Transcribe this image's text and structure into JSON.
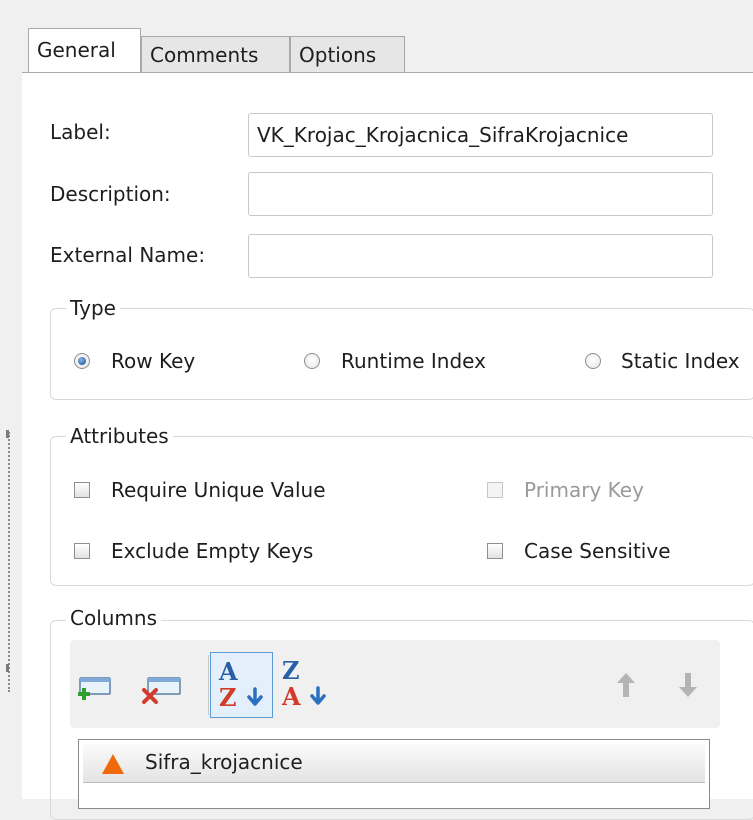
{
  "tabs": [
    {
      "label": "General"
    },
    {
      "label": "Comments"
    },
    {
      "label": "Options"
    }
  ],
  "form": {
    "label_caption": "Label:",
    "label_value": "VK_Krojac_Krojacnica_SifraKrojacnice",
    "description_caption": "Description:",
    "description_value": "",
    "external_name_caption": "External Name:",
    "external_name_value": ""
  },
  "type_group": {
    "title": "Type",
    "options": [
      {
        "label": "Row Key",
        "selected": true
      },
      {
        "label": "Runtime Index",
        "selected": false
      },
      {
        "label": "Static Index",
        "selected": false
      }
    ]
  },
  "attributes_group": {
    "title": "Attributes",
    "require_unique": {
      "label": "Require Unique Value",
      "checked": false,
      "enabled": true
    },
    "primary_key": {
      "label": "Primary Key",
      "checked": false,
      "enabled": false
    },
    "exclude_empty": {
      "label": "Exclude Empty Keys",
      "checked": false,
      "enabled": true
    },
    "case_sensitive": {
      "label": "Case Sensitive",
      "checked": false,
      "enabled": true
    }
  },
  "columns_group": {
    "title": "Columns",
    "toolbar": {
      "sort_asc_top": "A",
      "sort_asc_bottom": "Z",
      "sort_desc_top": "Z",
      "sort_desc_bottom": "A"
    },
    "rows": [
      {
        "name": "Sifra_krojacnice"
      }
    ]
  },
  "colors": {
    "accent": "#2a5fa8",
    "warning_triangle": "#f06a0a",
    "add_green": "#2f9e2f",
    "remove_red": "#d23a2a"
  }
}
